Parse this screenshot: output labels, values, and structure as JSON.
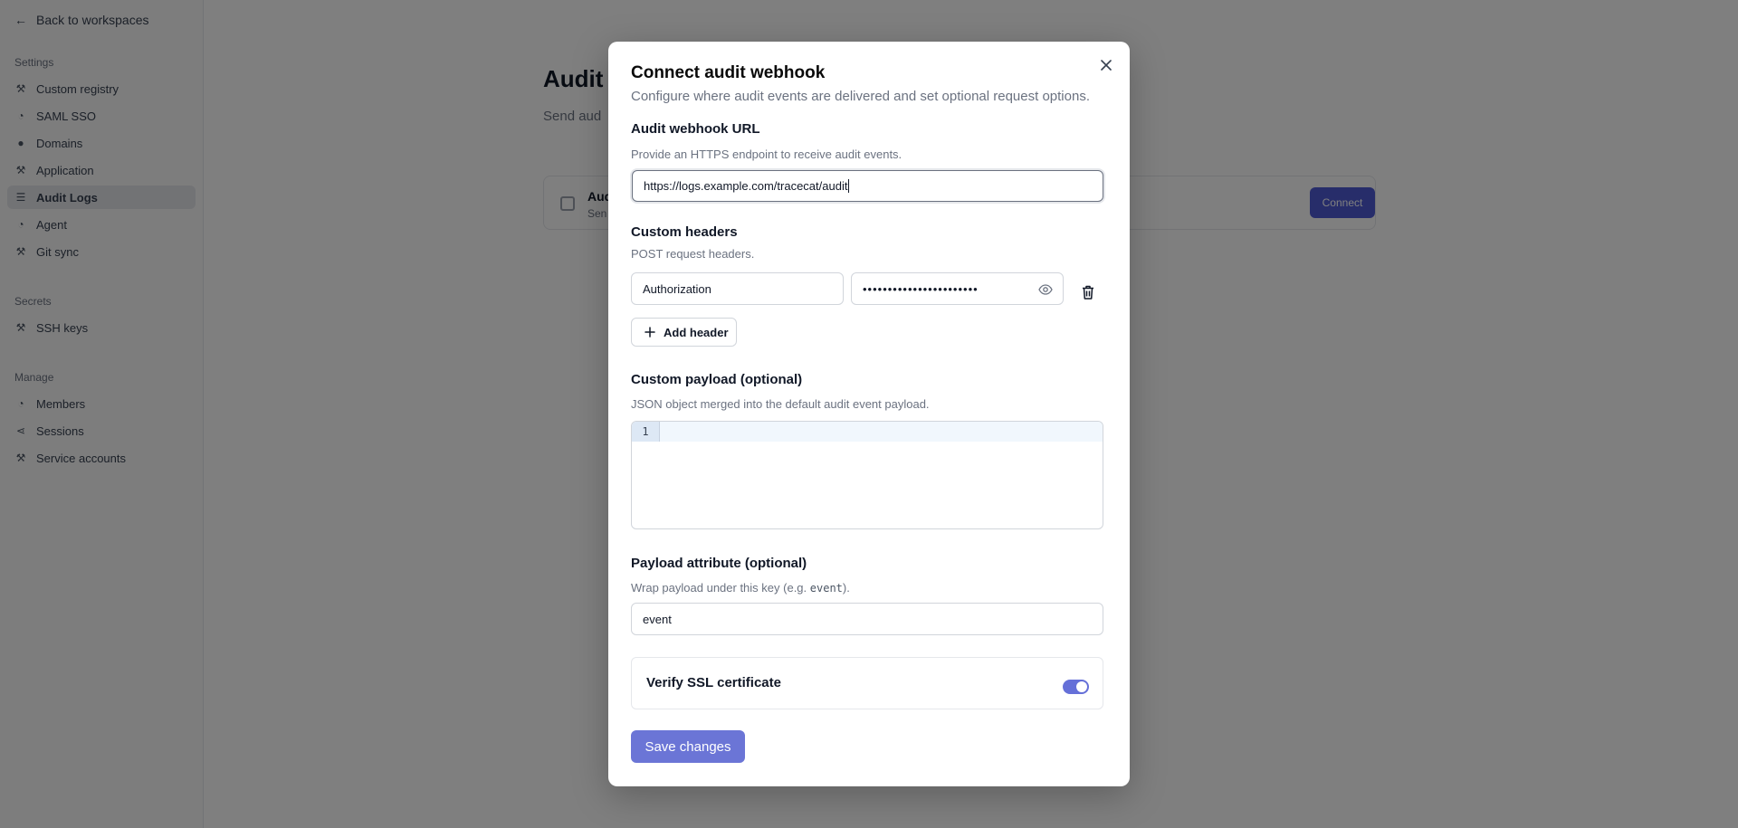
{
  "background": {
    "back_label": "Back to workspaces",
    "sidebar": {
      "section_settings": "Settings",
      "settings_items": [
        {
          "label": "Custom registry",
          "icon": "wrench-icon"
        },
        {
          "label": "SAML SSO",
          "icon": "user-icon"
        },
        {
          "label": "Domains",
          "icon": "globe-icon"
        },
        {
          "label": "Application",
          "icon": "wrench-icon"
        },
        {
          "label": "Audit Logs",
          "icon": "list-icon"
        },
        {
          "label": "Agent",
          "icon": "user-icon"
        },
        {
          "label": "Git sync",
          "icon": "wrench-icon"
        }
      ],
      "section_secrets": "Secrets",
      "secrets_items": [
        {
          "label": "SSH keys",
          "icon": "wrench-icon"
        }
      ],
      "section_manage": "Manage",
      "manage_items": [
        {
          "label": "Members",
          "icon": "user-icon"
        },
        {
          "label": "Sessions",
          "icon": "share-icon"
        },
        {
          "label": "Service accounts",
          "icon": "wrench-icon"
        }
      ]
    },
    "main": {
      "title": "Audit l",
      "subtitle": "Send aud",
      "card_title": "Aud",
      "card_subtitle": "Sen",
      "card_button": "Connect"
    }
  },
  "dialog": {
    "title": "Connect audit webhook",
    "description": "Configure where audit events are delivered and set optional request options.",
    "url_label": "Audit webhook URL",
    "url_help": "Provide an HTTPS endpoint to receive audit events.",
    "url_value": "https://logs.example.com/tracecat/audit",
    "headers_label": "Custom headers",
    "headers_help": "POST request headers.",
    "header_name_value": "Authorization",
    "header_value_masked": "•••••••••••••••••••••••",
    "add_header_label": "Add header",
    "payload_label": "Custom payload (optional)",
    "payload_help": "JSON object merged into the default audit event payload.",
    "payload_line_number": "1",
    "attribute_label": "Payload attribute (optional)",
    "attribute_help_prefix": "Wrap payload under this key (e.g. ",
    "attribute_help_code": "event",
    "attribute_help_suffix": ").",
    "attribute_value": "event",
    "ssl_label": "Verify SSL certificate",
    "ssl_enabled": true,
    "save_label": "Save changes",
    "accent_color": "#6b75d6"
  }
}
